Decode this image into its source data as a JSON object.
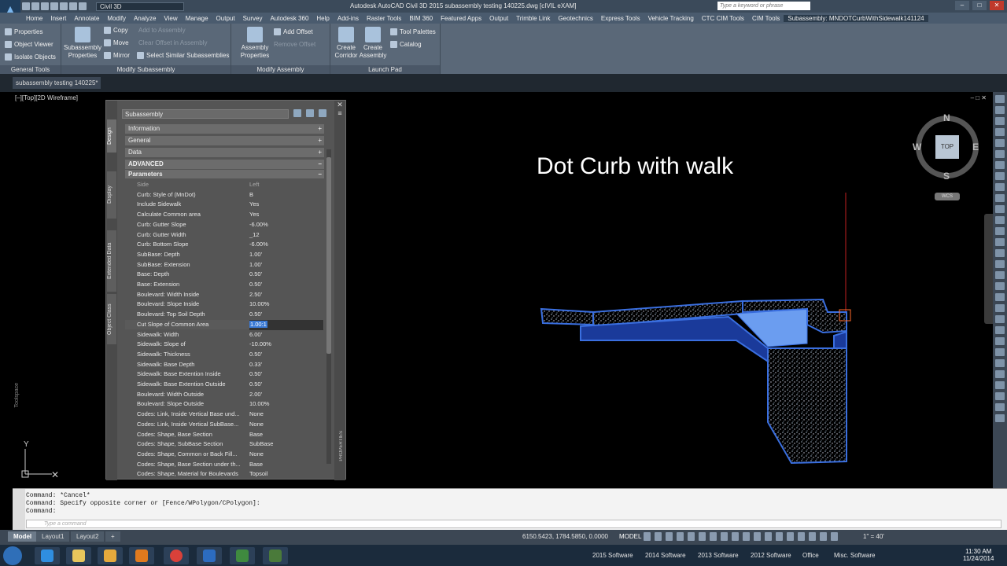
{
  "titlebar": {
    "workspace": "Civil 3D",
    "title": "Autodesk AutoCAD Civil 3D 2015    subassembly testing 140225.dwg [cIVIL eXAM]",
    "search_placeholder": "Type a keyword or phrase"
  },
  "menu": [
    "Home",
    "Insert",
    "Annotate",
    "Modify",
    "Analyze",
    "View",
    "Manage",
    "Output",
    "Survey",
    "Autodesk 360",
    "Help",
    "Add-ins",
    "Raster Tools",
    "BIM 360",
    "Featured Apps",
    "Output",
    "Trimble Link",
    "Geotechnics",
    "Express Tools",
    "Vehicle Tracking",
    "CTC CIM Tools",
    "CIM Tools",
    "Subassembly: MNDOTCurbWithSidewalk141124"
  ],
  "ribbon": {
    "general_tools": {
      "title": "General Tools",
      "properties": "Properties",
      "object_viewer": "Object Viewer",
      "isolate_objects": "Isolate Objects"
    },
    "modify_subassembly": {
      "title": "Modify Subassembly",
      "subassembly_properties": "Subassembly Properties",
      "copy": "Copy",
      "move": "Move",
      "mirror": "Mirror",
      "add_to_assembly": "Add to Assembly",
      "clear_offset": "Clear Offset in Assembly",
      "select_similar": "Select Similar Subassemblies"
    },
    "modify_assembly": {
      "title": "Modify Assembly",
      "assembly_properties": "Assembly Properties",
      "add_offset": "Add Offset",
      "remove_offset": "Remove Offset"
    },
    "launch_pad": {
      "title": "Launch Pad",
      "create_corridor": "Create Corridor",
      "create_assembly": "Create Assembly",
      "tool_palettes": "Tool Palettes",
      "catalog": "Catalog"
    }
  },
  "doc_tab": "subassembly testing 140225*",
  "viewport": {
    "label": "[–][Top][2D Wireframe]",
    "drawing_title": "Dot Curb with walk",
    "viewcube": {
      "top": "TOP",
      "n": "N",
      "s": "S",
      "e": "E",
      "w": "W",
      "wcs": "WCS"
    },
    "ucs_y": "Y",
    "toolspace": "Toolspace"
  },
  "palette": {
    "selector": "Subassembly",
    "tabs": [
      "Design",
      "Display",
      "Extended Data",
      "Object Class"
    ],
    "sections": {
      "information": "Information",
      "general": "General",
      "data": "Data",
      "advanced": "ADVANCED",
      "parameters": "Parameters"
    },
    "properties_label": "PROPERTIES",
    "rows": [
      {
        "name": "Side",
        "value": "Left"
      },
      {
        "name": "Curb: Style of (MnDot)",
        "value": "B"
      },
      {
        "name": "Include Sidewalk",
        "value": "Yes"
      },
      {
        "name": "Calculate Common area",
        "value": "Yes"
      },
      {
        "name": "Curb: Gutter Slope",
        "value": "-6.00%"
      },
      {
        "name": "Curb: Gutter Width",
        "value": "_12"
      },
      {
        "name": "Curb: Bottom Slope",
        "value": "-6.00%"
      },
      {
        "name": "SubBase: Depth",
        "value": "1.00'"
      },
      {
        "name": "SubBase: Extension",
        "value": "1.00'"
      },
      {
        "name": "Base: Depth",
        "value": "0.50'"
      },
      {
        "name": "Base: Extension",
        "value": "0.50'"
      },
      {
        "name": "Boulevard: Width Inside",
        "value": "2.50'"
      },
      {
        "name": "Boulevard: Slope Inside",
        "value": "10.00%"
      },
      {
        "name": "Boulevard: Top Soil Depth",
        "value": "0.50'"
      },
      {
        "name": "Cut Slope of Common Area",
        "value": "1.00:1"
      },
      {
        "name": "Sidewalk: Width",
        "value": "6.00'"
      },
      {
        "name": "Sidewalk: Slope of",
        "value": "-10.00%"
      },
      {
        "name": "Sidewalk: Thickness",
        "value": "0.50'"
      },
      {
        "name": "Sidewalk: Base Depth",
        "value": "0.33'"
      },
      {
        "name": "Sidewalk: Base Extention Inside",
        "value": "0.50'"
      },
      {
        "name": "Sidewalk: Base Extention Outside",
        "value": "0.50'"
      },
      {
        "name": "Boulevard: Width Outside",
        "value": "2.00'"
      },
      {
        "name": "Boulevard: Slope Outside",
        "value": "10.00%"
      },
      {
        "name": "Codes: Link, Inside Vertical Base und...",
        "value": "None"
      },
      {
        "name": "Codes: Link, Inside Vertical SubBase...",
        "value": "None"
      },
      {
        "name": "Codes: Shape, Base Section",
        "value": "Base"
      },
      {
        "name": "Codes: Shape, SubBase Section",
        "value": "SubBase"
      },
      {
        "name": "Codes: Shape, Common or Back Fill...",
        "value": "None"
      },
      {
        "name": "Codes: Shape, Base Section under th...",
        "value": "Base"
      },
      {
        "name": "Codes: Shape, Material for Boulevards",
        "value": "Topsoil"
      }
    ]
  },
  "command": {
    "history": [
      "Command: *Cancel*",
      "Command: Specify opposite corner or [Fence/WPolygon/CPolygon]:",
      "Command:"
    ],
    "placeholder": "Type a command"
  },
  "status": {
    "tabs": [
      "Model",
      "Layout1",
      "Layout2"
    ],
    "coords": "6150.5423, 1784.5850, 0.0000",
    "model": "MODEL",
    "scale": "1\" = 40'"
  },
  "taskbar": {
    "labels": [
      "2015 Software",
      "2014 Software",
      "2013 Software",
      "2012 Software",
      "Office",
      "Misc. Software"
    ],
    "time": "11:30 AM",
    "date": "11/24/2014"
  }
}
